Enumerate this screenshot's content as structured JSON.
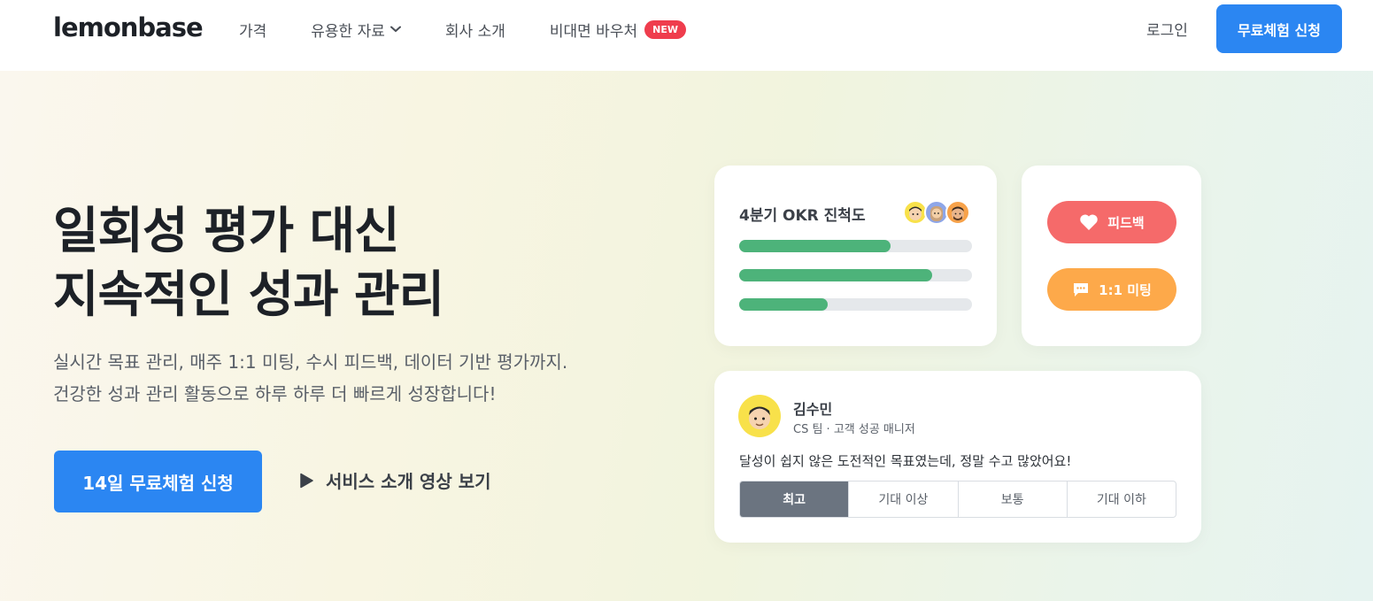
{
  "header": {
    "logo": "lemonbase",
    "nav": [
      {
        "label": "가격"
      },
      {
        "label": "유용한 자료"
      },
      {
        "label": "회사 소개"
      },
      {
        "label": "비대면 바우처",
        "badge": "NEW"
      }
    ],
    "login": "로그인",
    "cta": "무료체험 신청"
  },
  "hero": {
    "headline_line1": "일회성 평가 대신",
    "headline_line2": "지속적인 성과 관리",
    "sub_line1": "실시간 목표 관리, 매주 1:1 미팅, 수시 피드백, 데이터 기반 평가까지.",
    "sub_line2": "건강한 성과 관리 활동으로 하루 하루 더 빠르게 성장합니다!",
    "cta": "14일 무료체험 신청",
    "video_link": "서비스 소개 영상 보기"
  },
  "okr_card": {
    "title": "4분기 OKR 진척도",
    "progress": [
      0.65,
      0.83,
      0.38
    ],
    "progress_color": "#4db37a"
  },
  "action_card": {
    "feedback": "피드백",
    "meeting": "1:1 미팅"
  },
  "review_card": {
    "name": "김수민",
    "role": "CS 팀 · 고객 성공 매니저",
    "text": "달성이 쉽지 않은 도전적인 목표였는데, 정말 수고 많았어요!",
    "ratings": [
      "최고",
      "기대 이상",
      "보통",
      "기대 이하"
    ],
    "selected": "최고"
  },
  "colors": {
    "primary": "#2b86f2",
    "new_badge": "#ef3d4d",
    "feedback": "#f56a6a",
    "meeting": "#fda94a"
  }
}
